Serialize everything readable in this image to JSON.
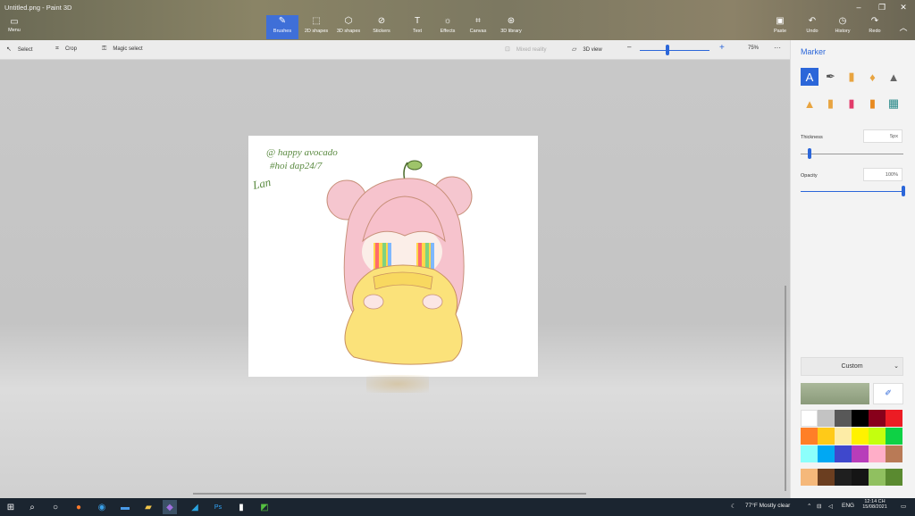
{
  "window": {
    "title": "Untitled.png - Paint 3D"
  },
  "menu": {
    "label": "Menu"
  },
  "ribbon": {
    "tools": [
      {
        "label": "Brushes",
        "icon": "brush-icon",
        "glyph": "✎",
        "active": true
      },
      {
        "label": "2D shapes",
        "icon": "2d-shapes-icon",
        "glyph": "⬚"
      },
      {
        "label": "3D shapes",
        "icon": "3d-shapes-icon",
        "glyph": "⬡"
      },
      {
        "label": "Stickers",
        "icon": "stickers-icon",
        "glyph": "⊘"
      },
      {
        "label": "Text",
        "icon": "text-icon",
        "glyph": "T"
      },
      {
        "label": "Effects",
        "icon": "effects-icon",
        "glyph": "☼"
      },
      {
        "label": "Canvas",
        "icon": "canvas-icon",
        "glyph": "⌗"
      },
      {
        "label": "3D library",
        "icon": "3d-library-icon",
        "glyph": "⊛"
      }
    ],
    "right_tools": [
      {
        "label": "Paste",
        "icon": "paste-icon",
        "glyph": "▣"
      },
      {
        "label": "Undo",
        "icon": "undo-icon",
        "glyph": "↶"
      },
      {
        "label": "History",
        "icon": "history-icon",
        "glyph": "◷"
      },
      {
        "label": "Redo",
        "icon": "redo-icon",
        "glyph": "↷"
      }
    ]
  },
  "toolbar": {
    "select": "Select",
    "crop": "Crop",
    "magic_select": "Magic select",
    "mixed_reality": "Mixed reality",
    "view_3d": "3D view",
    "zoom": "75%",
    "zoom_level": 0.4,
    "more": "···"
  },
  "panel": {
    "title": "Marker",
    "thickness_label": "Thickness",
    "thickness_value": "5px",
    "thickness_level": 0.05,
    "opacity_label": "Opacity",
    "opacity_value": "100%",
    "opacity_level": 1.0,
    "custom_label": "Custom",
    "current_color": "#8a9a7a",
    "brushes": [
      {
        "icon": "marker-icon",
        "glyph": "A",
        "color": "#2b66d9",
        "active": true
      },
      {
        "icon": "calligraphy-pen-icon",
        "glyph": "✒",
        "color": "#555"
      },
      {
        "icon": "oil-brush-icon",
        "glyph": "▮",
        "color": "#e8a440"
      },
      {
        "icon": "watercolor-icon",
        "glyph": "♦",
        "color": "#e8a440"
      },
      {
        "icon": "pixel-pen-icon",
        "glyph": "▲",
        "color": "#666"
      },
      {
        "icon": "pencil-icon",
        "glyph": "▲",
        "color": "#e8a440"
      },
      {
        "icon": "eraser-icon",
        "glyph": "▮",
        "color": "#e8a440"
      },
      {
        "icon": "crayon-icon",
        "glyph": "▮",
        "color": "#e23b6a"
      },
      {
        "icon": "spray-can-icon",
        "glyph": "▮",
        "color": "#e88a20"
      },
      {
        "icon": "fill-icon",
        "glyph": "▦",
        "color": "#2a8a8a"
      }
    ],
    "palette": [
      "#ffffff",
      "#c3c3c3",
      "#585858",
      "#000000",
      "#88001b",
      "#ec1c24",
      "#ff7f27",
      "#ffca18",
      "#fdeca6",
      "#fff200",
      "#c4ff0e",
      "#0ed145",
      "#8cfffb",
      "#00a8f3",
      "#3f48cc",
      "#b83dba",
      "#ffaec8",
      "#b97a56",
      "#f5b87a",
      "#6b3e20",
      "#1f1f1f",
      "#151515",
      "#90c060",
      "#5a8a30"
    ]
  },
  "canvas_text": {
    "line1": "@ happy avocado",
    "line2": "#hoi dap24/7",
    "signature": "Lan"
  },
  "taskbar": {
    "weather": "77°F  Mostly clear",
    "lang": "ENG",
    "time": "12:14 CH",
    "date": "15/08/2021"
  }
}
